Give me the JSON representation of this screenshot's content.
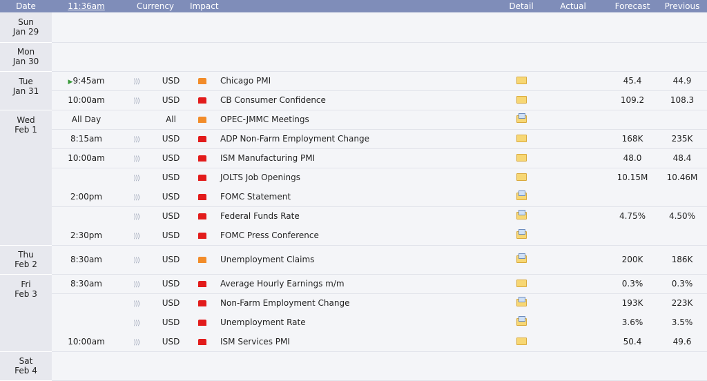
{
  "header": {
    "date": "Date",
    "time": "11:36am",
    "currency": "Currency",
    "impact": "Impact",
    "detail": "Detail",
    "actual": "Actual",
    "forecast": "Forecast",
    "previous": "Previous"
  },
  "colors": {
    "header_bg": "#7f8db9",
    "high_impact": "#e21b1b",
    "medium_impact": "#f28c2a",
    "date_bg": "#e7e8ee"
  },
  "days": [
    {
      "dow": "Sun",
      "date": "Jan 29",
      "events": []
    },
    {
      "dow": "Mon",
      "date": "Jan 30",
      "events": []
    },
    {
      "dow": "Tue",
      "date": "Jan 31",
      "events": [
        {
          "time": "9:45am",
          "playing": true,
          "currency": "USD",
          "impact": "medium",
          "title": "Chicago PMI",
          "detail": "folder",
          "actual": "",
          "forecast": "45.4",
          "previous": "44.9"
        },
        {
          "time": "10:00am",
          "currency": "USD",
          "impact": "high",
          "title": "CB Consumer Confidence",
          "detail": "folder",
          "actual": "",
          "forecast": "109.2",
          "previous": "108.3"
        }
      ]
    },
    {
      "dow": "Wed",
      "date": "Feb 1",
      "events": [
        {
          "time": "All Day",
          "currency": "All",
          "impact": "medium",
          "title": "OPEC-JMMC Meetings",
          "detail": "doc",
          "actual": "",
          "forecast": "",
          "previous": "",
          "nosound": true
        },
        {
          "time": "8:15am",
          "currency": "USD",
          "impact": "high",
          "title": "ADP Non-Farm Employment Change",
          "detail": "folder",
          "actual": "",
          "forecast": "168K",
          "previous": "235K"
        },
        {
          "time": "10:00am",
          "currency": "USD",
          "impact": "high",
          "title": "ISM Manufacturing PMI",
          "detail": "folder",
          "actual": "",
          "forecast": "48.0",
          "previous": "48.4"
        },
        {
          "time": "",
          "currency": "USD",
          "impact": "high",
          "title": "JOLTS Job Openings",
          "detail": "folder",
          "actual": "",
          "forecast": "10.15M",
          "previous": "10.46M"
        },
        {
          "time": "2:00pm",
          "currency": "USD",
          "impact": "high",
          "title": "FOMC Statement",
          "detail": "doc",
          "actual": "",
          "forecast": "",
          "previous": ""
        },
        {
          "time": "",
          "currency": "USD",
          "impact": "high",
          "title": "Federal Funds Rate",
          "detail": "doc",
          "actual": "",
          "forecast": "4.75%",
          "previous": "4.50%"
        },
        {
          "time": "2:30pm",
          "currency": "USD",
          "impact": "high",
          "title": "FOMC Press Conference",
          "detail": "doc",
          "actual": "",
          "forecast": "",
          "previous": ""
        }
      ]
    },
    {
      "dow": "Thu",
      "date": "Feb 2",
      "events": [
        {
          "time": "8:30am",
          "currency": "USD",
          "impact": "medium",
          "title": "Unemployment Claims",
          "detail": "doc",
          "actual": "",
          "forecast": "200K",
          "previous": "186K",
          "tall": true
        }
      ]
    },
    {
      "dow": "Fri",
      "date": "Feb 3",
      "events": [
        {
          "time": "8:30am",
          "currency": "USD",
          "impact": "high",
          "title": "Average Hourly Earnings m/m",
          "detail": "folder",
          "actual": "",
          "forecast": "0.3%",
          "previous": "0.3%"
        },
        {
          "time": "",
          "currency": "USD",
          "impact": "high",
          "title": "Non-Farm Employment Change",
          "detail": "doc",
          "actual": "",
          "forecast": "193K",
          "previous": "223K"
        },
        {
          "time": "",
          "currency": "USD",
          "impact": "high",
          "title": "Unemployment Rate",
          "detail": "doc",
          "actual": "",
          "forecast": "3.6%",
          "previous": "3.5%"
        },
        {
          "time": "10:00am",
          "currency": "USD",
          "impact": "high",
          "title": "ISM Services PMI",
          "detail": "folder",
          "actual": "",
          "forecast": "50.4",
          "previous": "49.6"
        }
      ]
    },
    {
      "dow": "Sat",
      "date": "Feb 4",
      "events": []
    }
  ]
}
